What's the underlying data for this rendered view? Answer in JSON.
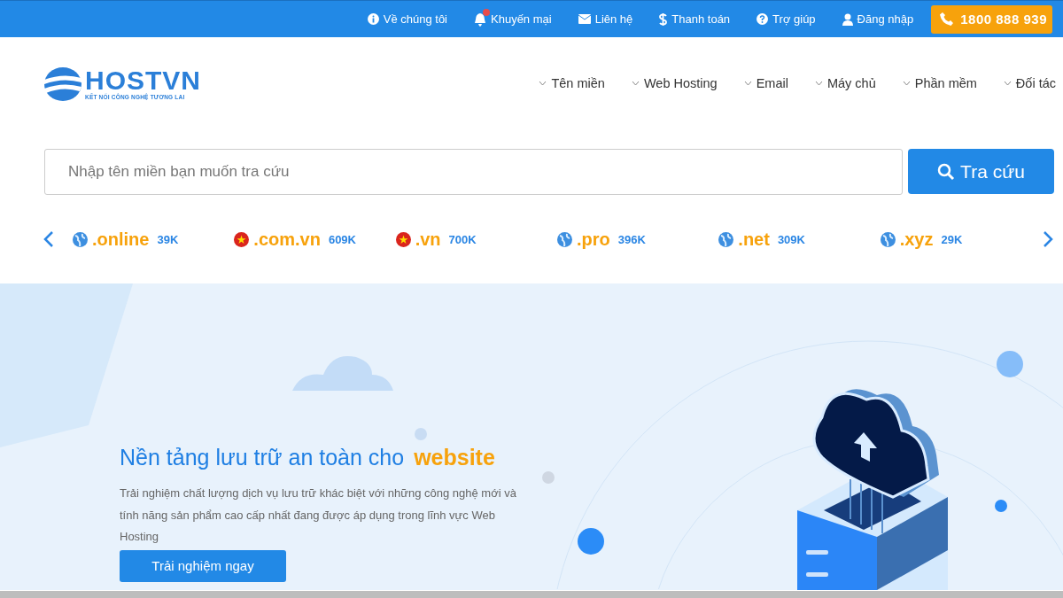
{
  "top_bar": {
    "links": [
      {
        "label": "Về chúng tôi",
        "kind": "info"
      },
      {
        "label": "Khuyến mại",
        "kind": "bell",
        "badge": true
      },
      {
        "label": "Liên hệ",
        "kind": "mail"
      },
      {
        "label": "Thanh toán",
        "kind": "dollar"
      },
      {
        "label": "Trợ giúp",
        "kind": "help"
      },
      {
        "label": "Đăng nhập",
        "kind": "user"
      }
    ],
    "hotline": "1800 888 939"
  },
  "header": {
    "logo": {
      "name": "HOSTVN",
      "tagline": "KẾT NỐI CÔNG NGHỆ TƯƠNG LAI"
    },
    "nav": [
      "Tên miền",
      "Web Hosting",
      "Email",
      "Máy chủ",
      "Phần mềm",
      "Đối tác"
    ]
  },
  "search": {
    "placeholder": "Nhập tên miền bạn muốn tra cứu",
    "button": "Tra cứu"
  },
  "domains": [
    {
      "name": ".online",
      "count": "39K",
      "kind": "globe"
    },
    {
      "name": ".com.vn",
      "count": "609K",
      "kind": "vn"
    },
    {
      "name": ".vn",
      "count": "700K",
      "kind": "vn"
    },
    {
      "name": ".pro",
      "count": "396K",
      "kind": "globe"
    },
    {
      "name": ".net",
      "count": "309K",
      "kind": "globe"
    },
    {
      "name": ".xyz",
      "count": "29K",
      "kind": "globe"
    }
  ],
  "hero": {
    "title": "Nền tảng lưu trữ an toàn cho",
    "highlight": "website",
    "description": "Trải nghiệm chất lượng dịch vụ lưu trữ khác biệt với những công nghệ mới và tính năng sản phẩm cao cấp nhất đang được áp dụng trong lĩnh vực Web Hosting",
    "button": "Trải nghiệm ngay"
  }
}
